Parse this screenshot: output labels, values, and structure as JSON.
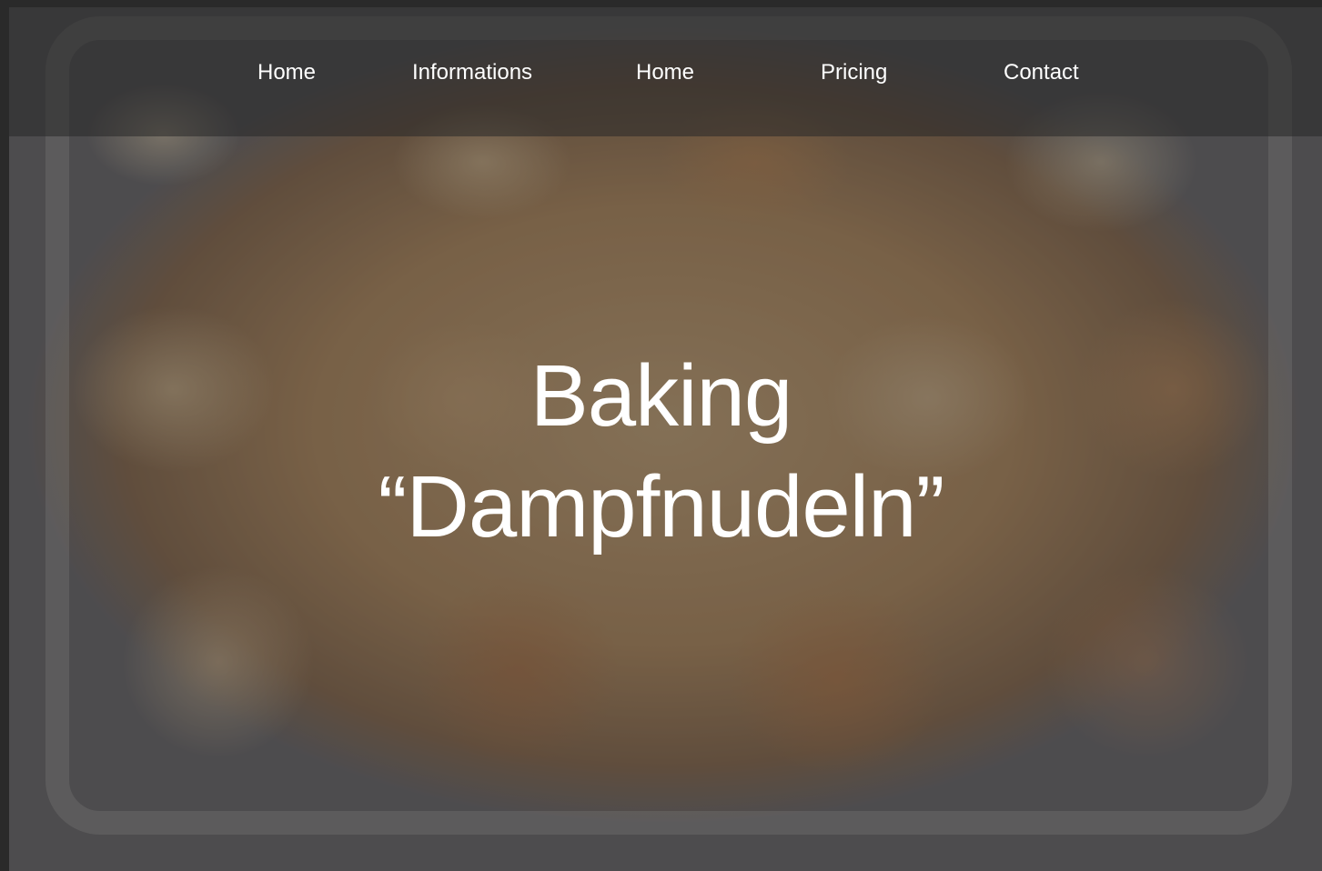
{
  "nav": {
    "items": [
      {
        "label": "Home"
      },
      {
        "label": "Informations"
      },
      {
        "label": "Home"
      },
      {
        "label": "Pricing"
      },
      {
        "label": "Contact"
      }
    ]
  },
  "hero": {
    "title_line1": "Baking",
    "title_line2": "“Dampfnudeln”"
  },
  "colors": {
    "nav_text": "#ffffff",
    "title_text": "#ffffff",
    "navbar_bg": "#282828"
  }
}
